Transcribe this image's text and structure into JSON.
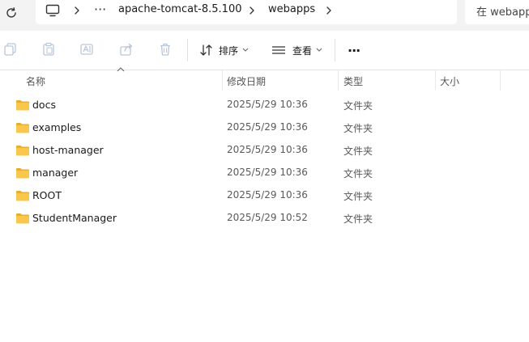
{
  "address_bar": {
    "overflow_label": "···",
    "crumbs": [
      "apache-tomcat-8.5.100",
      "webapps"
    ],
    "search_placeholder": "在 webapps"
  },
  "toolbar": {
    "sort_label": "排序",
    "view_label": "查看",
    "more_label": "···"
  },
  "columns": {
    "name": "名称",
    "modified": "修改日期",
    "type": "类型",
    "size": "大小"
  },
  "files": [
    {
      "name": "docs",
      "modified": "2025/5/29 10:36",
      "type": "文件夹"
    },
    {
      "name": "examples",
      "modified": "2025/5/29 10:36",
      "type": "文件夹"
    },
    {
      "name": "host-manager",
      "modified": "2025/5/29 10:36",
      "type": "文件夹"
    },
    {
      "name": "manager",
      "modified": "2025/5/29 10:36",
      "type": "文件夹"
    },
    {
      "name": "ROOT",
      "modified": "2025/5/29 10:36",
      "type": "文件夹"
    },
    {
      "name": "StudentManager",
      "modified": "2025/5/29 10:52",
      "type": "文件夹"
    }
  ],
  "colors": {
    "folder": "#f8c74c",
    "folder_dark": "#e9ae2e",
    "disabled_icon": "#b9c6d9"
  }
}
